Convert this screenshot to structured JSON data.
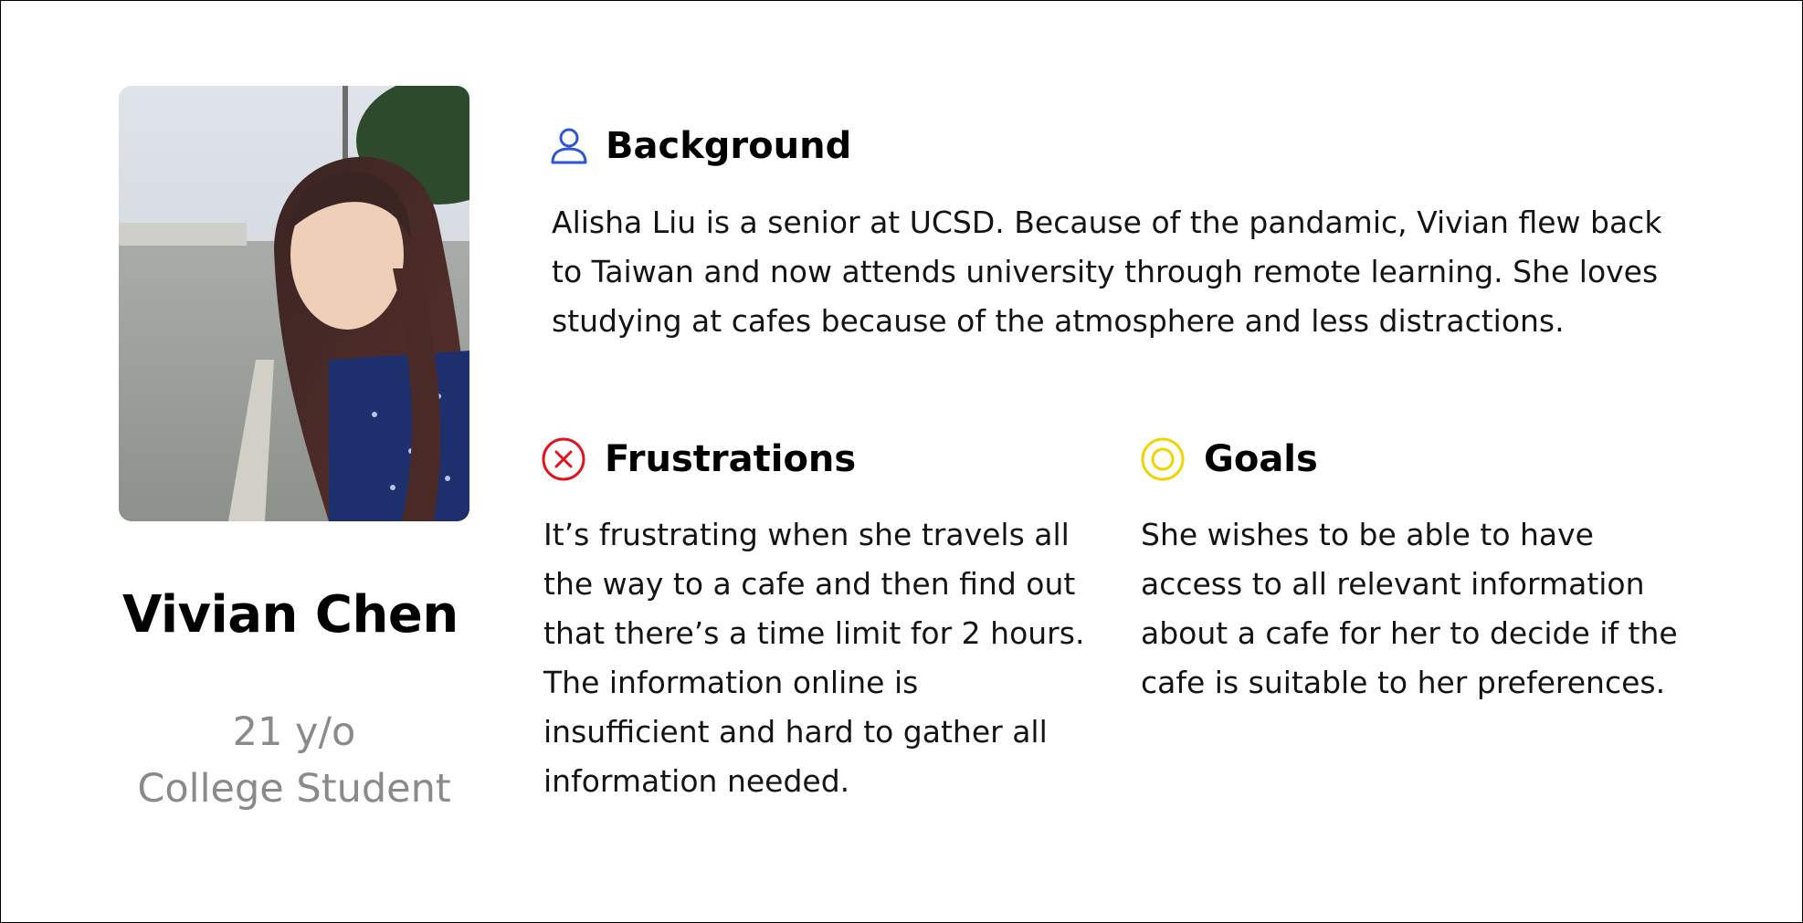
{
  "colors": {
    "background_icon": "#2f56d8",
    "frustrations_icon": "#e0141e",
    "goals_icon": "#f2d300",
    "meta_text": "#8a8a8a"
  },
  "profile": {
    "photo_alt": "Portrait photo",
    "name": "Vivian Chen",
    "age": "21 y/o",
    "occupation": "College Student"
  },
  "background": {
    "icon": "person-icon",
    "title": "Background",
    "lines": [
      "Alisha Liu is a senior at UCSD. Because of the pandamic, Vivian flew back",
      "to Taiwan and now attends university through remote learning. She loves",
      "studying at cafes because of the atmosphere and less distractions."
    ]
  },
  "frustrations": {
    "icon": "x-circle-icon",
    "title": "Frustrations",
    "lines": [
      "It’s frustrating when she travels all",
      "the way to a cafe and then find out",
      "that there’s a time limit for 2 hours.",
      "The information online is",
      "insufficient and hard to gather all",
      "information needed."
    ]
  },
  "goals": {
    "icon": "target-icon",
    "title": "Goals",
    "lines": [
      "She wishes to be able to have",
      "access to all relevant information",
      "about a cafe for her to decide if the",
      "cafe is suitable to her preferences."
    ]
  }
}
